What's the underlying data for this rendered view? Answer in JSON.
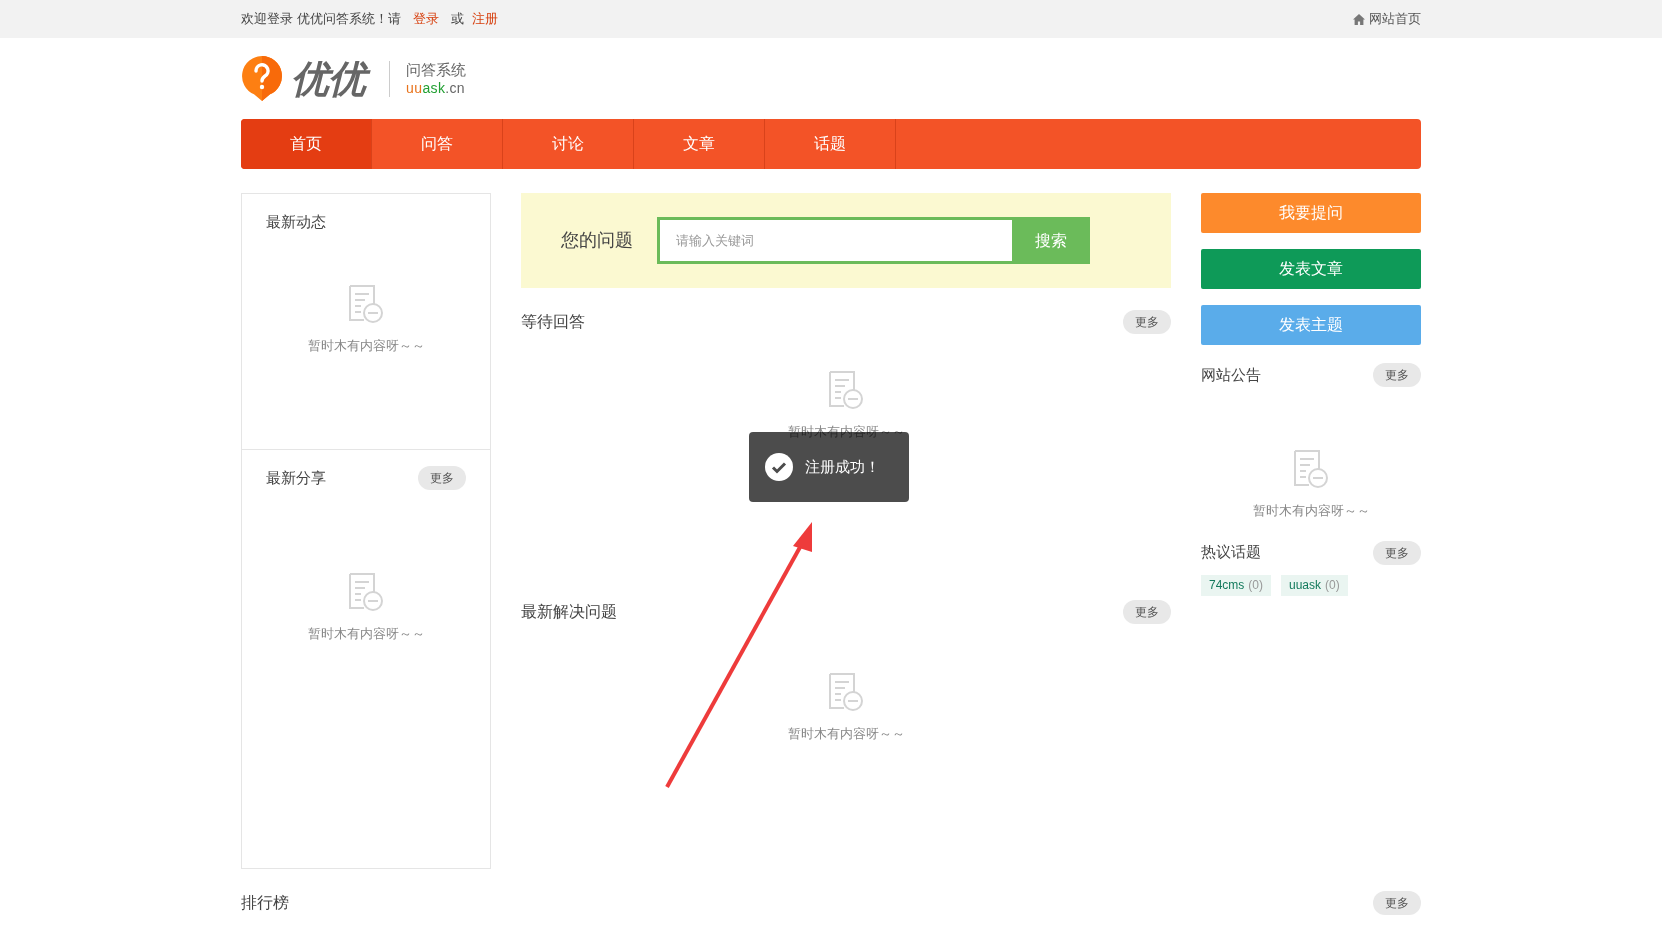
{
  "top_bar": {
    "welcome": "欢迎登录 优优问答系统！请",
    "login": "登录",
    "or": "或",
    "register": "注册",
    "home_link": "网站首页"
  },
  "logo": {
    "name": "优优",
    "subtitle": "问答系统",
    "domain_parts": [
      {
        "text": "uu",
        "color": "#e8731c"
      },
      {
        "text": "ask",
        "color": "#22a033"
      },
      {
        "text": ".cn",
        "color": "#666666"
      }
    ]
  },
  "nav": [
    {
      "label": "首页",
      "selected": true
    },
    {
      "label": "问答",
      "selected": false
    },
    {
      "label": "讨论",
      "selected": false
    },
    {
      "label": "文章",
      "selected": false
    },
    {
      "label": "话题",
      "selected": false
    }
  ],
  "left_panels": [
    {
      "title": "最新动态",
      "empty_text": "暂时木有内容呀～～"
    },
    {
      "title": "最新分享",
      "more": "更多",
      "empty_text": "暂时木有内容呀～～"
    }
  ],
  "search": {
    "label": "您的问题",
    "placeholder": "请输入关键词",
    "button": "搜索"
  },
  "sections": [
    {
      "title": "等待回答",
      "more": "更多",
      "empty_text": "暂时木有内容呀～～"
    },
    {
      "title": "最新解决问题",
      "more": "更多",
      "empty_text": "暂时木有内容呀～～"
    }
  ],
  "action_buttons": [
    {
      "label": "我要提问",
      "color": "#fd8a2c"
    },
    {
      "label": "发表文章",
      "color": "#0e9a58"
    },
    {
      "label": "发表主题",
      "color": "#5aacea"
    }
  ],
  "notice": {
    "title": "网站公告",
    "more": "更多",
    "empty_text": "暂时木有内容呀～～"
  },
  "hot_topics": {
    "title": "热议话题",
    "more": "更多",
    "tags": [
      {
        "name": "74cms",
        "count": "(0)"
      },
      {
        "name": "uuask",
        "count": "(0)"
      }
    ]
  },
  "ranking": {
    "title": "排行榜",
    "more": "更多"
  },
  "toast": {
    "text": "注册成功！"
  }
}
